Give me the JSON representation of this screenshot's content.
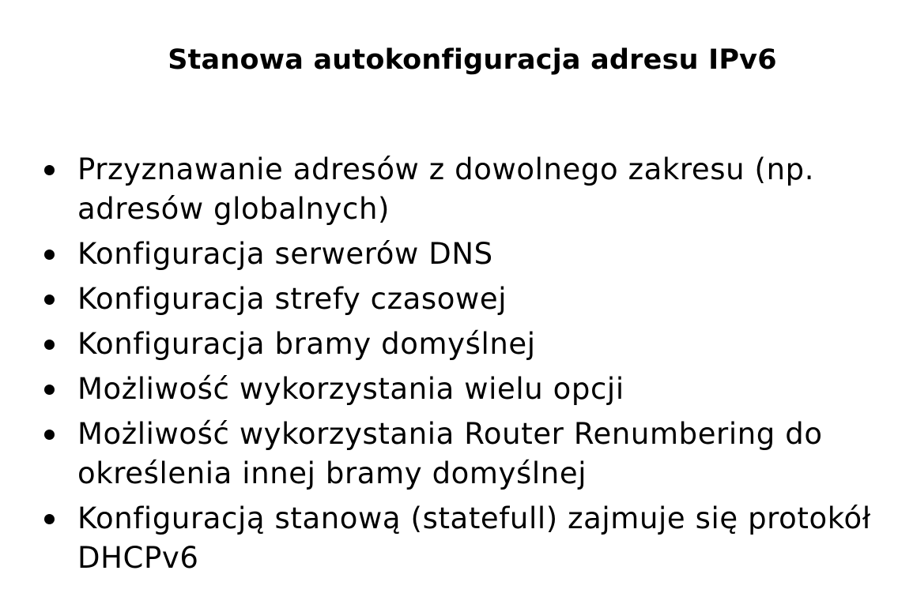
{
  "slide": {
    "title": "Stanowa autokonfiguracja adresu IPv6",
    "bullets": [
      {
        "text": "Przyznawanie adresów z dowolnego zakresu (np. adresów globalnych)"
      },
      {
        "text": "Konfiguracja serwerów DNS"
      },
      {
        "text": "Konfiguracja strefy czasowej"
      },
      {
        "text": "Konfiguracja bramy domyślnej"
      },
      {
        "text": "Możliwość wykorzystania wielu opcji"
      },
      {
        "text": "Możliwość wykorzystania Router Renumbering do określenia innej bramy domyślnej"
      },
      {
        "text": "Konfiguracją stanową (statefull) zajmuje się protokół DHCPv6"
      }
    ]
  }
}
